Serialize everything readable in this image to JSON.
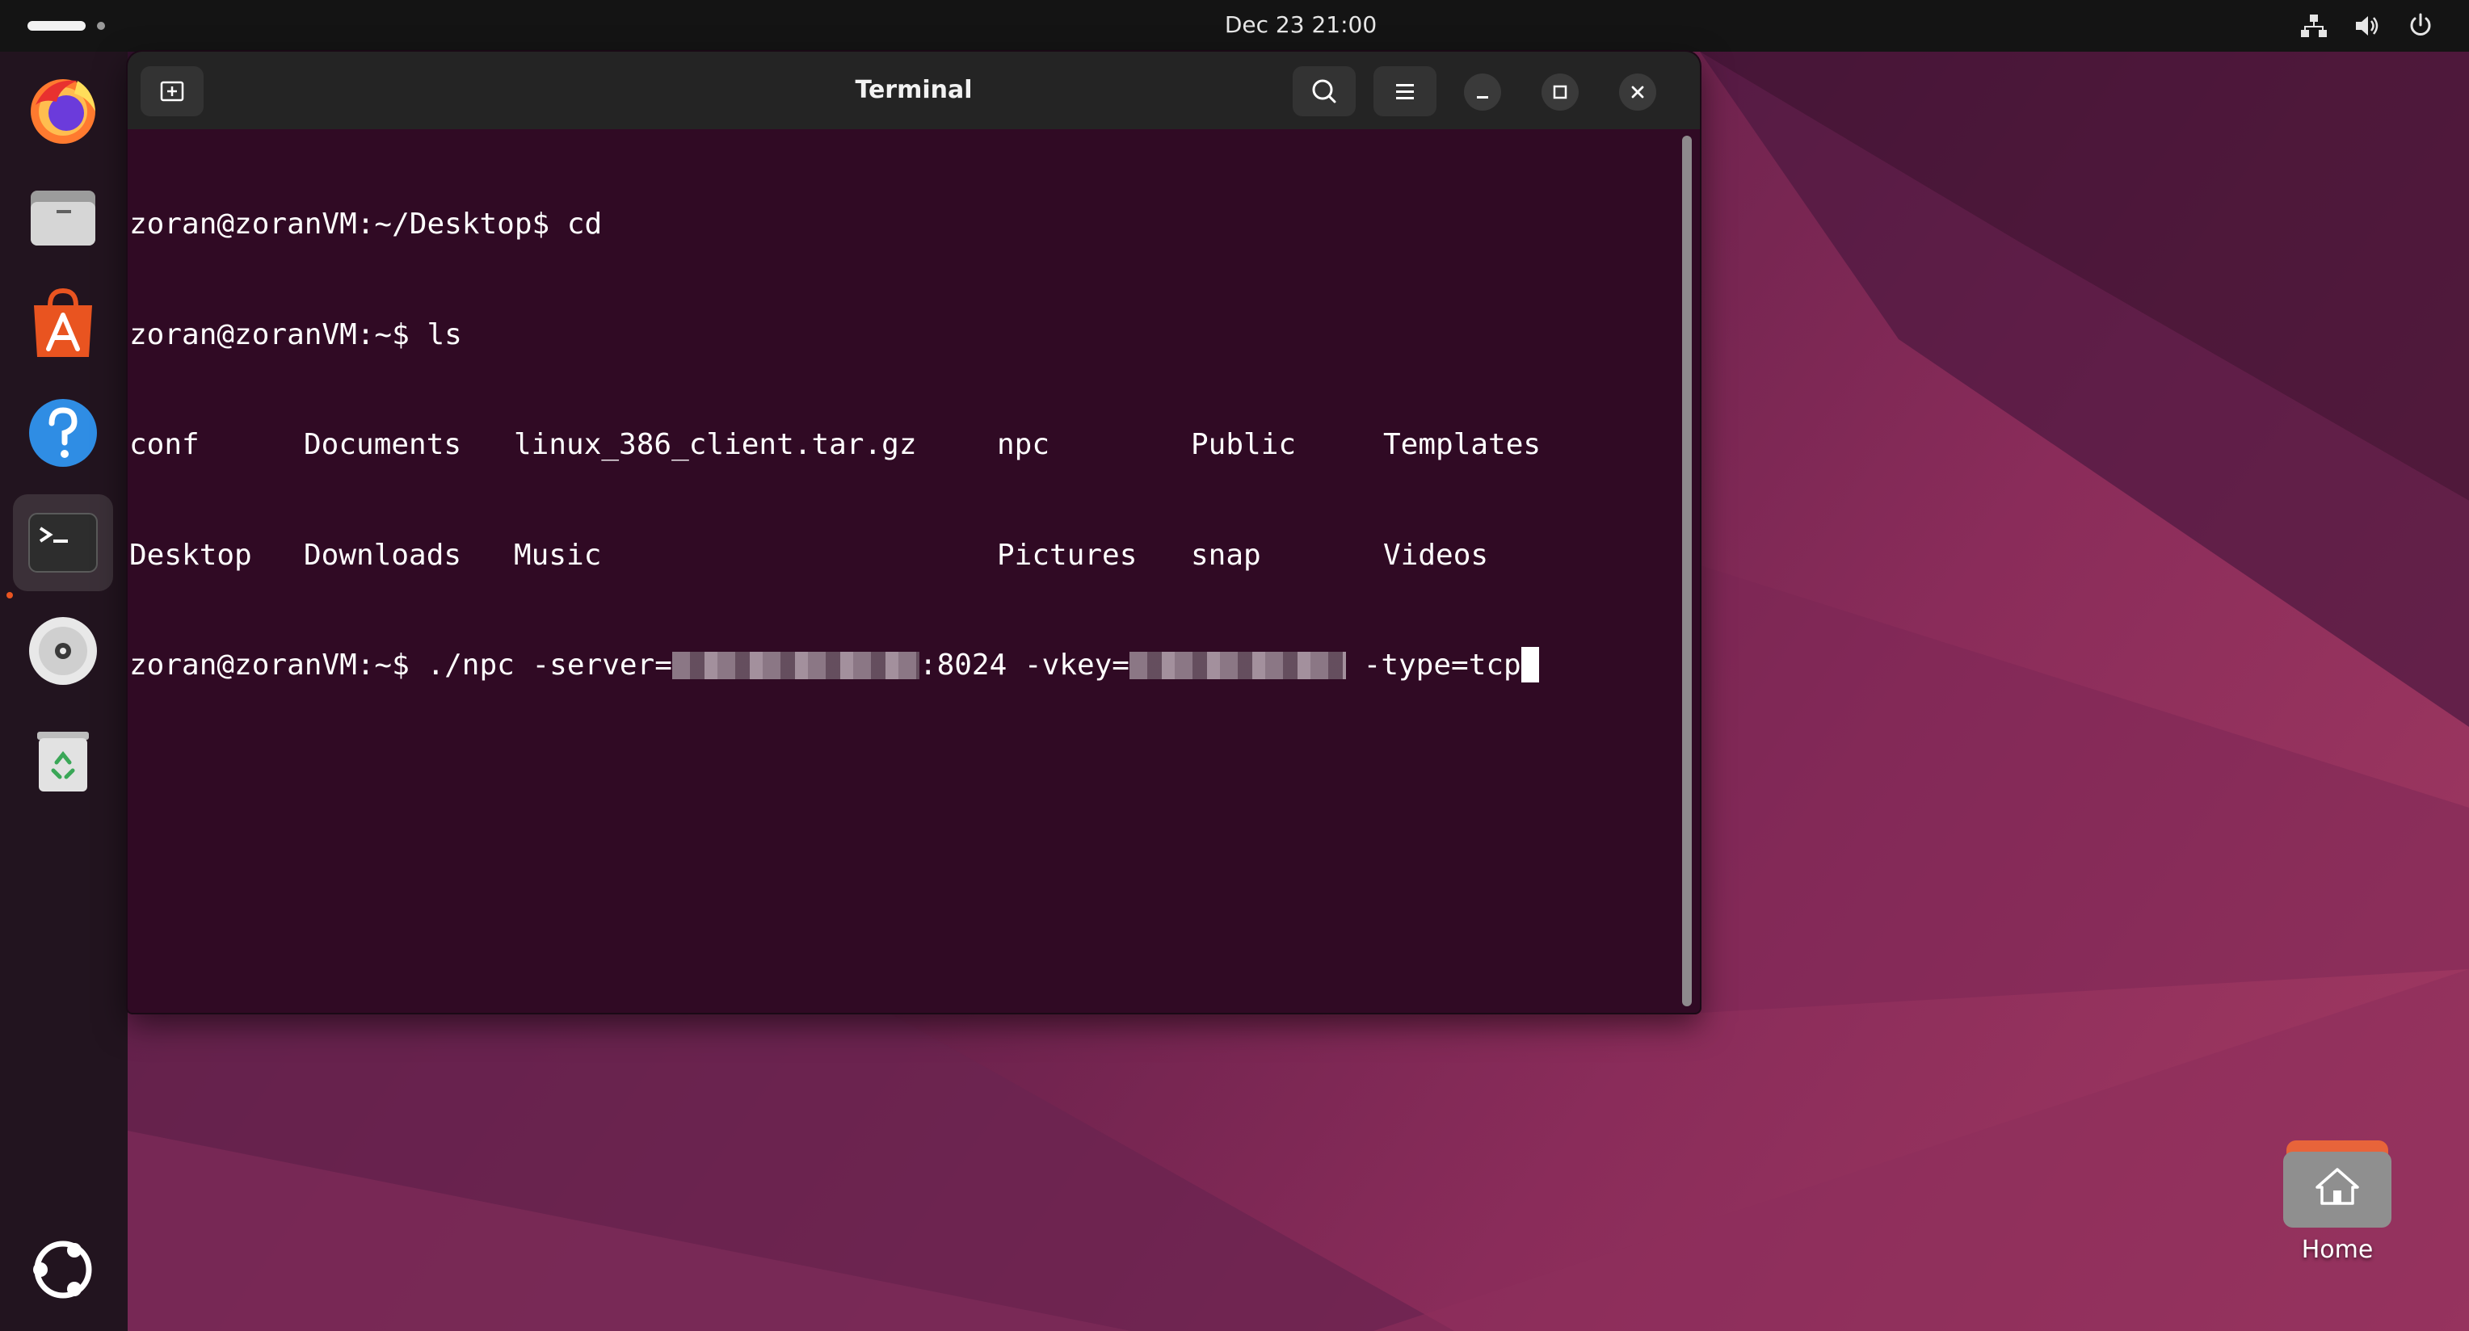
{
  "topbar": {
    "clock": "Dec 23  21:00",
    "tray_icons": [
      "network-icon",
      "volume-icon",
      "power-icon"
    ]
  },
  "dock": {
    "items": [
      {
        "name": "firefox",
        "icon": "firefox-icon"
      },
      {
        "name": "files",
        "icon": "files-icon"
      },
      {
        "name": "app-center",
        "icon": "app-center-icon"
      },
      {
        "name": "help",
        "icon": "help-icon"
      },
      {
        "name": "terminal",
        "icon": "terminal-icon",
        "active": true
      },
      {
        "name": "disc",
        "icon": "disc-icon"
      },
      {
        "name": "trash",
        "icon": "trash-icon"
      }
    ],
    "show_apps_icon": "ubuntu-logo-icon"
  },
  "terminal": {
    "title": "Terminal",
    "lines": {
      "line1": "zoran@zoranVM:~/Desktop$ cd",
      "line2": "zoran@zoranVM:~$ ls",
      "ls_row1": [
        "conf",
        "Documents",
        "linux_386_client.tar.gz",
        "npc",
        "Public",
        "Templates"
      ],
      "ls_row2": [
        "Desktop",
        "Downloads",
        "Music",
        "Pictures",
        "snap",
        "Videos"
      ],
      "cmd_prompt": "zoran@zoranVM:~$ ./npc -server=",
      "cmd_port": ":8024 -vkey=",
      "cmd_type": " -type=tcp"
    }
  },
  "desktop": {
    "home_label": "Home"
  },
  "colors": {
    "terminal_bg": "#300a24",
    "accent": "#e95420",
    "headerbar": "#242424"
  }
}
